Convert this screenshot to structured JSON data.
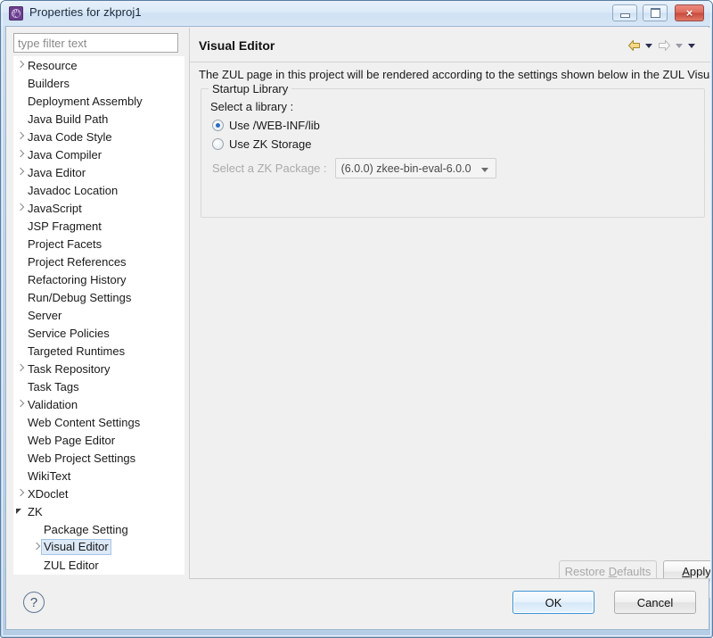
{
  "window": {
    "title": "Properties for zkproj1",
    "icon": "properties-gear-icon",
    "minimize_label": "Minimize",
    "maximize_label": "Maximize",
    "close_label": "×"
  },
  "sidebar": {
    "filter": {
      "placeholder": "type filter text",
      "value": ""
    },
    "items": [
      {
        "label": "Resource",
        "arrow": "collapsed",
        "indent": 0,
        "selected": false
      },
      {
        "label": "Builders",
        "arrow": "none",
        "indent": 0,
        "selected": false
      },
      {
        "label": "Deployment Assembly",
        "arrow": "none",
        "indent": 0,
        "selected": false
      },
      {
        "label": "Java Build Path",
        "arrow": "none",
        "indent": 0,
        "selected": false
      },
      {
        "label": "Java Code Style",
        "arrow": "collapsed",
        "indent": 0,
        "selected": false
      },
      {
        "label": "Java Compiler",
        "arrow": "collapsed",
        "indent": 0,
        "selected": false
      },
      {
        "label": "Java Editor",
        "arrow": "collapsed",
        "indent": 0,
        "selected": false
      },
      {
        "label": "Javadoc Location",
        "arrow": "none",
        "indent": 0,
        "selected": false
      },
      {
        "label": "JavaScript",
        "arrow": "collapsed",
        "indent": 0,
        "selected": false
      },
      {
        "label": "JSP Fragment",
        "arrow": "none",
        "indent": 0,
        "selected": false
      },
      {
        "label": "Project Facets",
        "arrow": "none",
        "indent": 0,
        "selected": false
      },
      {
        "label": "Project References",
        "arrow": "none",
        "indent": 0,
        "selected": false
      },
      {
        "label": "Refactoring History",
        "arrow": "none",
        "indent": 0,
        "selected": false
      },
      {
        "label": "Run/Debug Settings",
        "arrow": "none",
        "indent": 0,
        "selected": false
      },
      {
        "label": "Server",
        "arrow": "none",
        "indent": 0,
        "selected": false
      },
      {
        "label": "Service Policies",
        "arrow": "none",
        "indent": 0,
        "selected": false
      },
      {
        "label": "Targeted Runtimes",
        "arrow": "none",
        "indent": 0,
        "selected": false
      },
      {
        "label": "Task Repository",
        "arrow": "collapsed",
        "indent": 0,
        "selected": false
      },
      {
        "label": "Task Tags",
        "arrow": "none",
        "indent": 0,
        "selected": false
      },
      {
        "label": "Validation",
        "arrow": "collapsed",
        "indent": 0,
        "selected": false
      },
      {
        "label": "Web Content Settings",
        "arrow": "none",
        "indent": 0,
        "selected": false
      },
      {
        "label": "Web Page Editor",
        "arrow": "none",
        "indent": 0,
        "selected": false
      },
      {
        "label": "Web Project Settings",
        "arrow": "none",
        "indent": 0,
        "selected": false
      },
      {
        "label": "WikiText",
        "arrow": "none",
        "indent": 0,
        "selected": false
      },
      {
        "label": "XDoclet",
        "arrow": "collapsed",
        "indent": 0,
        "selected": false
      },
      {
        "label": "ZK",
        "arrow": "expanded",
        "indent": 0,
        "selected": false
      },
      {
        "label": "Package Setting",
        "arrow": "none",
        "indent": 1,
        "selected": false
      },
      {
        "label": "Visual Editor",
        "arrow": "collapsed",
        "indent": 1,
        "selected": true
      },
      {
        "label": "ZUL Editor",
        "arrow": "none",
        "indent": 1,
        "selected": false
      }
    ]
  },
  "main": {
    "title": "Visual Editor",
    "nav": {
      "back_icon": "back-arrow-icon",
      "back_menu_icon": "chevron-down-icon",
      "forward_icon": "forward-arrow-icon",
      "forward_menu_icon": "chevron-down-icon",
      "menu_icon": "chevron-down-icon"
    },
    "description": "The ZUL page in this project will be rendered according to the settings shown below in the ZUL Visual Editor.",
    "group": {
      "legend": "Startup Library",
      "select_library_label": "Select a library :",
      "radios": [
        {
          "label": "Use /WEB-INF/lib",
          "checked": true
        },
        {
          "label": "Use ZK Storage",
          "checked": false
        }
      ],
      "package_label": "Select a ZK Package :",
      "package_value": "(6.0.0)  zkee-bin-eval-6.0.0",
      "package_options": [
        "(6.0.0)  zkee-bin-eval-6.0.0"
      ],
      "package_disabled": true
    },
    "restore_defaults_label": "Restore Defaults",
    "restore_defaults_mnemonic": "D",
    "apply_label": "Apply",
    "apply_mnemonic": "A",
    "scrollbar": {
      "left_arrow_icon": "scroll-left-arrow-icon",
      "right_arrow_icon": "scroll-right-arrow-icon",
      "grip_icon": "scroll-thumb-grip-icon"
    }
  },
  "footer": {
    "help_label": "?",
    "ok_label": "OK",
    "cancel_label": "Cancel"
  },
  "colors": {
    "accent": "#3c93d4",
    "title_icon": "#6b3f8f",
    "selection": "#dce9f7",
    "radio_dot": "#2a6fc0",
    "disabled_text": "#aaaaaa"
  }
}
